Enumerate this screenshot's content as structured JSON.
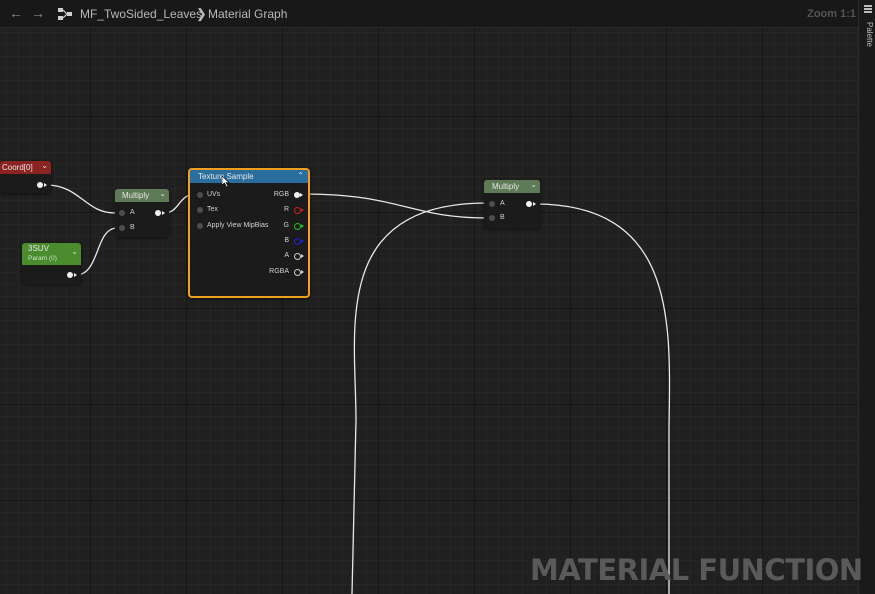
{
  "toolbar": {
    "back": "←",
    "forward": "→",
    "asset_name": "MF_TwoSided_Leaves",
    "separator": "❯",
    "graph_name": "Material Graph",
    "zoom": "Zoom 1:1"
  },
  "side_panel": {
    "palette_tab": "Palette"
  },
  "nodes": {
    "coord": {
      "title": "Coord[0]",
      "chevron": "⌄"
    },
    "multiply_left": {
      "title": "Multiply",
      "chevron": "⌄",
      "pin_a": "A",
      "pin_b": "B"
    },
    "param": {
      "title": "3SUV",
      "subtitle": "Param (0)",
      "chevron": "⌄"
    },
    "texture_sample": {
      "title": "Texture Sample",
      "chevron": "⌃",
      "inputs": [
        "UVs",
        "Tex",
        "Apply View MipBias"
      ],
      "outputs": [
        "RGB",
        "R",
        "G",
        "B",
        "A",
        "RGBA"
      ]
    },
    "multiply_right": {
      "title": "Multiply",
      "chevron": "⌄",
      "pin_a": "A",
      "pin_b": "B"
    }
  },
  "colors": {
    "coord_header": "#8c2323",
    "multiply_header": "#5e7a56",
    "param_header": "#4a8c2e",
    "texture_header": "#2a6e9e",
    "selection_border": "#f0a020",
    "wire": "#e8e8e8",
    "pin_r": "#d02020",
    "pin_g": "#20c020",
    "pin_b": "#2020d0"
  },
  "watermark": "MATERIAL FUNCTION"
}
